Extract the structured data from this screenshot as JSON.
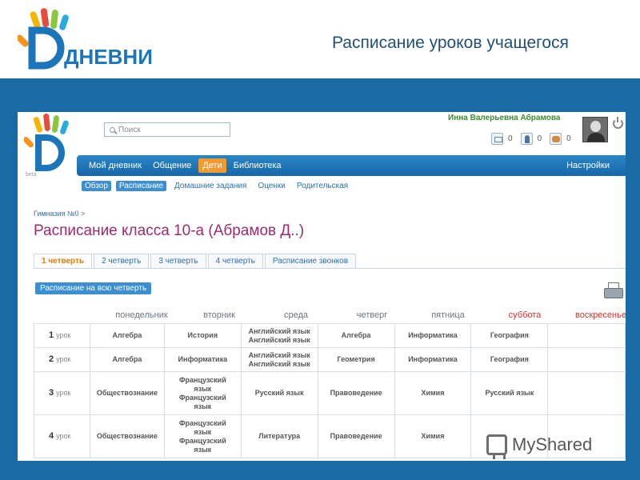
{
  "slide": {
    "title": "Расписание уроков учащегося",
    "logo_text": "ДНЕВНИК",
    "watermark": "MyShared"
  },
  "app": {
    "logo_label": "beta",
    "search": {
      "placeholder": "Поиск"
    },
    "user_name": "Инна Валерьевна Абрамова",
    "counters": [
      {
        "icon": "mail-icon",
        "value": "0"
      },
      {
        "icon": "person-icon",
        "value": "0"
      },
      {
        "icon": "group-icon",
        "value": "0"
      }
    ],
    "nav": {
      "items": [
        {
          "label": "Мой дневник",
          "active": false
        },
        {
          "label": "Общение",
          "active": false
        },
        {
          "label": "Дети",
          "active": true
        },
        {
          "label": "Библиотека",
          "active": false
        }
      ],
      "settings": "Настройки"
    },
    "subnav": [
      {
        "label": "Обзор",
        "pill": true
      },
      {
        "label": "Расписание",
        "pill": true
      },
      {
        "label": "Домашние задания",
        "pill": false
      },
      {
        "label": "Оценки",
        "pill": false
      },
      {
        "label": "Родительская",
        "pill": false
      }
    ],
    "breadcrumb": "Гимназия №0 >",
    "page_title": "Расписание класса 10-а (Абрамов Д..)",
    "tabs": [
      {
        "label": "1 четверть",
        "active": true
      },
      {
        "label": "2 четверть",
        "active": false
      },
      {
        "label": "3 четверть",
        "active": false
      },
      {
        "label": "4 четверть",
        "active": false
      },
      {
        "label": "Расписание звонков",
        "active": false
      }
    ],
    "quarter_button": "Расписание на всю четверть",
    "days": [
      "понедельник",
      "вторник",
      "среда",
      "четверг",
      "пятница",
      "суббота",
      "воскресенье"
    ],
    "lesson_word": "урок",
    "rows": [
      {
        "num": "1",
        "cells": [
          "Алгебра",
          "История",
          "Английский язык\nАнглийский язык",
          "Алгебра",
          "Информатика",
          "География",
          ""
        ]
      },
      {
        "num": "2",
        "cells": [
          "Алгебра",
          "Информатика",
          "Английский язык\nАнглийский язык",
          "Геометрия",
          "Информатика",
          "География",
          ""
        ]
      },
      {
        "num": "3",
        "cells": [
          "Обществознание",
          "Французский\nязык\nФранцузский\nязык",
          "Русский язык",
          "Правоведение",
          "Химия",
          "Русский язык",
          ""
        ]
      },
      {
        "num": "4",
        "cells": [
          "Обществознание",
          "Французский\nязык\nФранцузский\nязык",
          "Литература",
          "Правоведение",
          "Химия",
          "",
          ""
        ]
      }
    ]
  }
}
